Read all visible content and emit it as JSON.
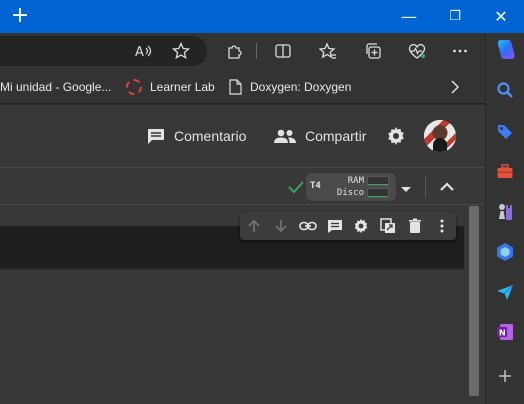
{
  "browser": {
    "new_tab_glyph": "+",
    "window_buttons": {
      "minimize": "—",
      "restore": "❐",
      "close": "✕"
    }
  },
  "favorites": [
    {
      "label": "Mi unidad - Google...",
      "icon": "google-drive-icon"
    },
    {
      "label": "Learner Lab",
      "icon": "dashed-circle-icon"
    },
    {
      "label": "Doxygen: Doxygen",
      "icon": "page-icon"
    }
  ],
  "header": {
    "comment_label": "Comentario",
    "share_label": "Compartir"
  },
  "runtime": {
    "accelerator": "T4",
    "ram_label": "RAM",
    "disk_label": "Disco",
    "ram_usage": 0.15,
    "disk_usage": 0.15,
    "status": "connected"
  },
  "colors": {
    "titlebar": "#0064d2",
    "accent_green": "#3aa35b",
    "onenote": "#7719aa"
  }
}
